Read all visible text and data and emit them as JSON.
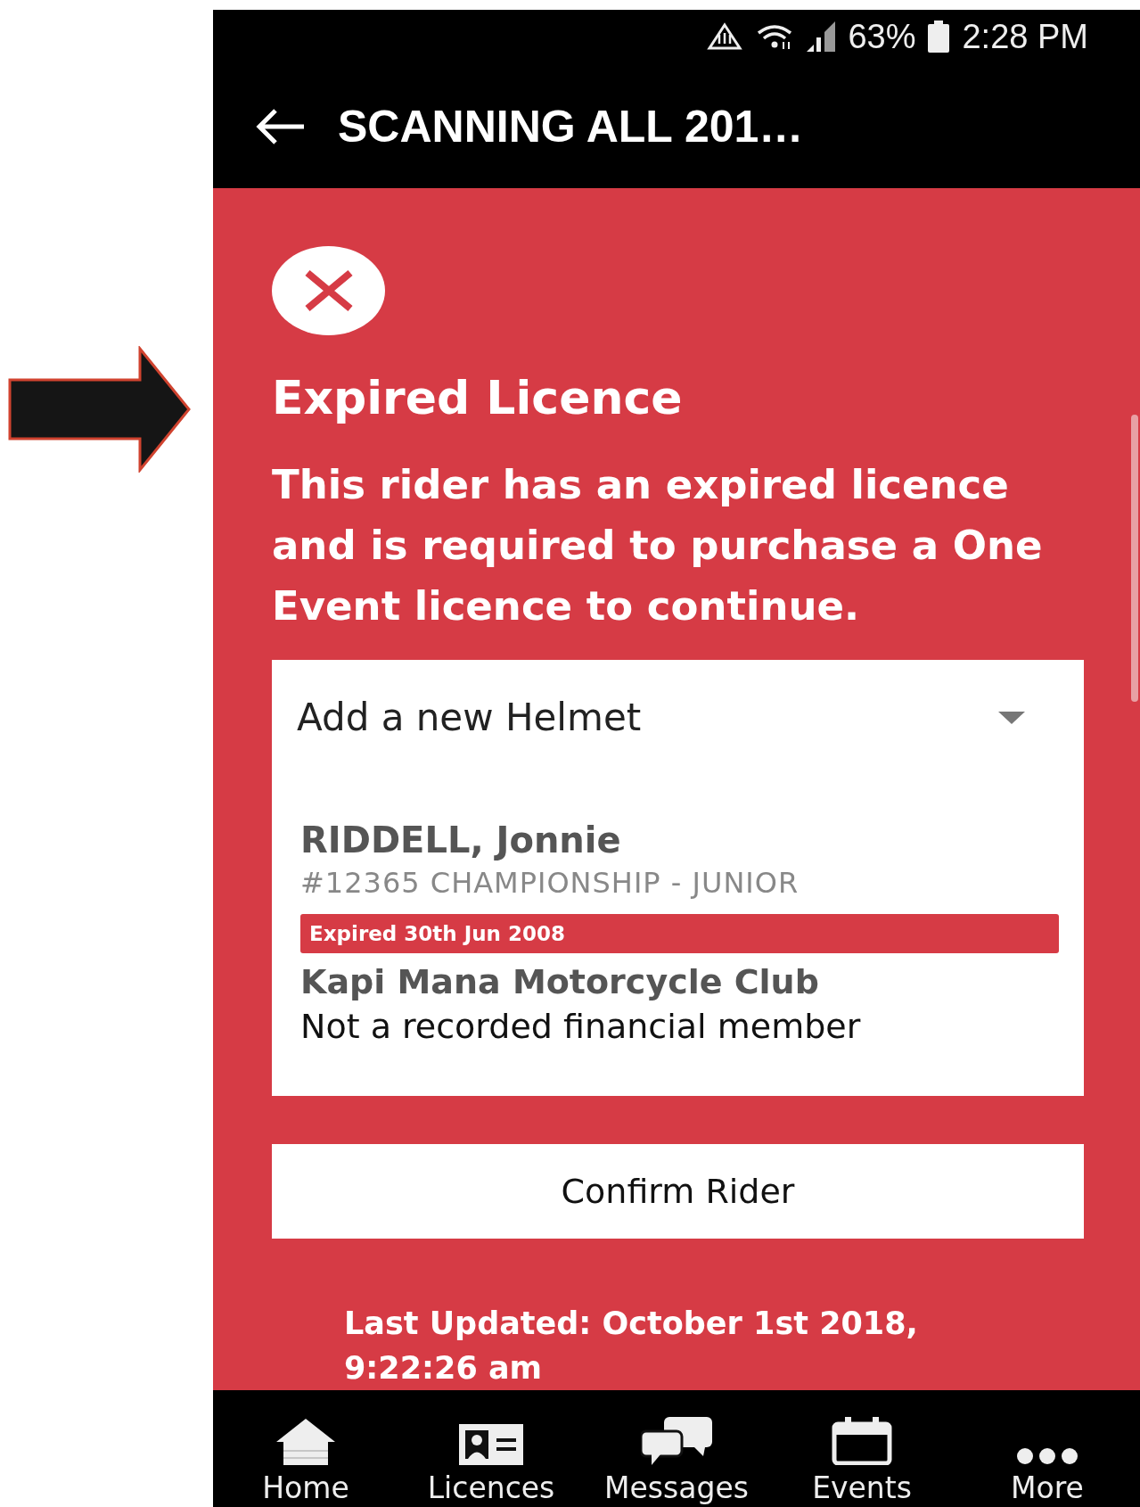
{
  "status_bar": {
    "battery": "63%",
    "time": "2:28 PM"
  },
  "app_bar": {
    "title": "SCANNING ALL 201…"
  },
  "alert": {
    "title": "Expired Licence",
    "message": "This rider has an expired licence and is required to purchase a One Event licence to continue."
  },
  "card": {
    "dropdown": {
      "value": "Add a new Helmet"
    },
    "rider": {
      "name": "RIDDELL, Jonnie",
      "details": "#12365 CHAMPIONSHIP - JUNIOR",
      "expiry": "Expired 30th Jun 2008",
      "club": "Kapi Mana Motorcycle Club",
      "membership": "Not a recorded financial member"
    }
  },
  "confirm_button": "Confirm Rider",
  "last_updated": "Last Updated: October 1st 2018, 9:22:26 am",
  "nav": [
    {
      "label": "Home"
    },
    {
      "label": "Licences"
    },
    {
      "label": "Messages"
    },
    {
      "label": "Events"
    },
    {
      "label": "More"
    }
  ]
}
